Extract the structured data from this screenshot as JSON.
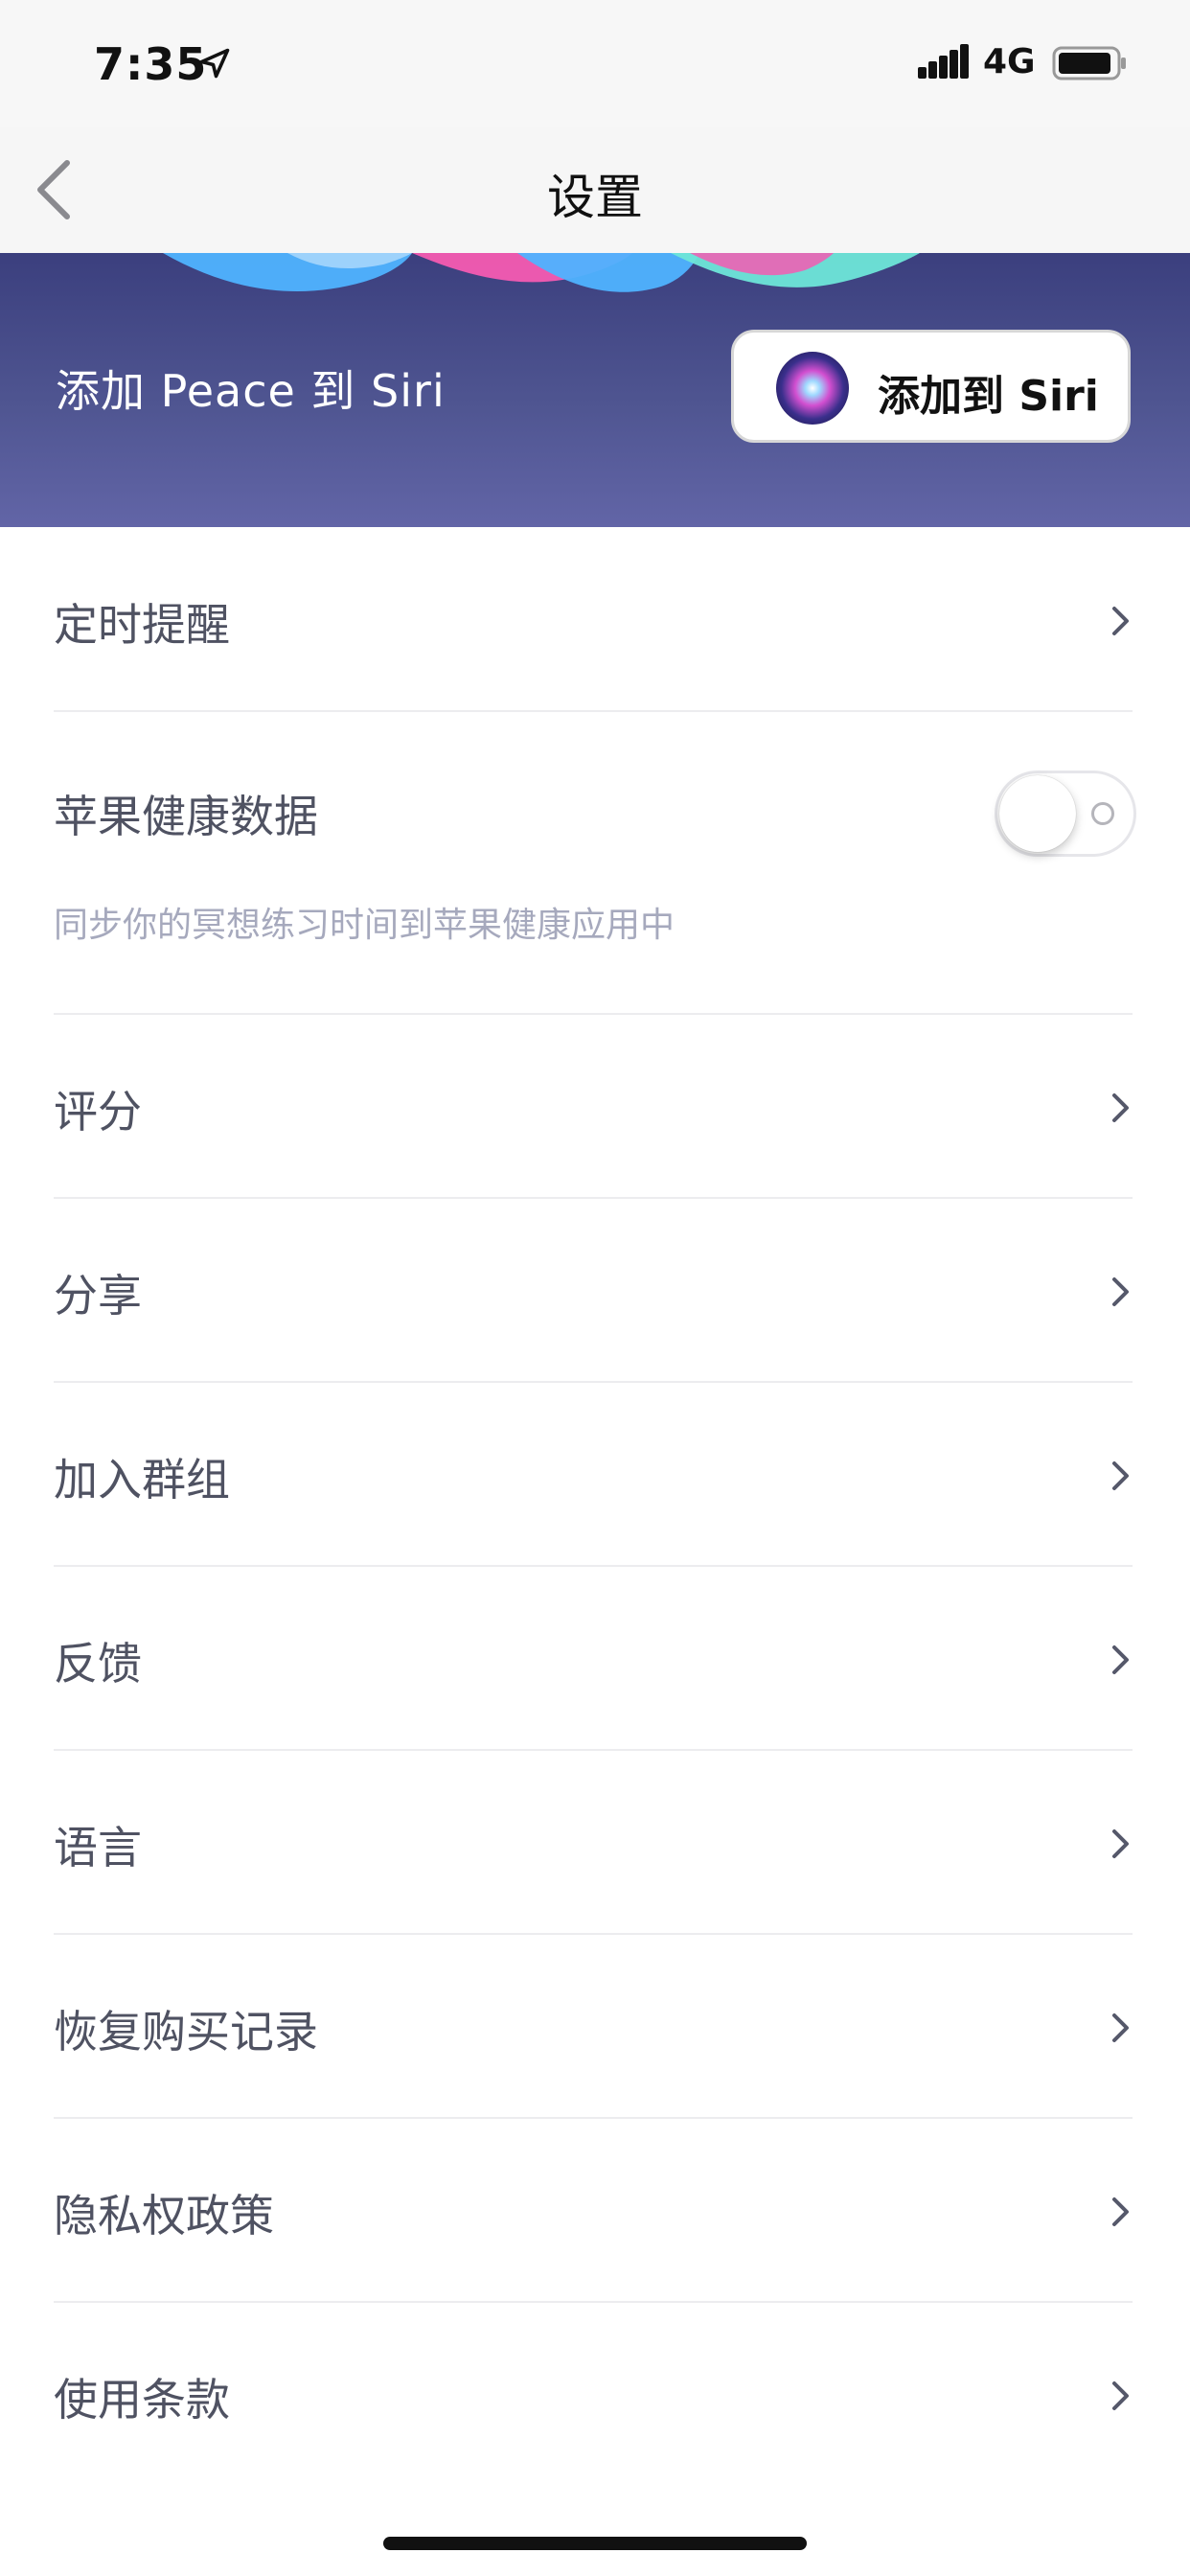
{
  "status_bar": {
    "time": "7:35",
    "network": "4G",
    "icons": [
      "location-arrow-icon",
      "signal-bars-icon",
      "battery-icon"
    ]
  },
  "nav": {
    "title": "设置",
    "back_icon": "chevron-left-icon"
  },
  "siri_banner": {
    "text": "添加 Peace 到 Siri",
    "button_label": "添加到 Siri",
    "button_icon": "siri-icon",
    "colors": {
      "gradient_top": "#3b3f7e",
      "gradient_bottom": "#6265a7",
      "wave_blue": "#4fb3ff",
      "wave_pink": "#f45bb1",
      "wave_teal": "#6ee6d8"
    }
  },
  "settings": {
    "reminder": {
      "label": "定时提醒"
    },
    "health": {
      "label": "苹果健康数据",
      "subtitle": "同步你的冥想练习时间到苹果健康应用中",
      "toggle_on": false
    },
    "items": [
      {
        "label": "评分"
      },
      {
        "label": "分享"
      },
      {
        "label": "加入群组"
      },
      {
        "label": "反馈"
      },
      {
        "label": "语言"
      },
      {
        "label": "恢复购买记录"
      },
      {
        "label": "隐私权政策"
      },
      {
        "label": "使用条款"
      }
    ]
  }
}
